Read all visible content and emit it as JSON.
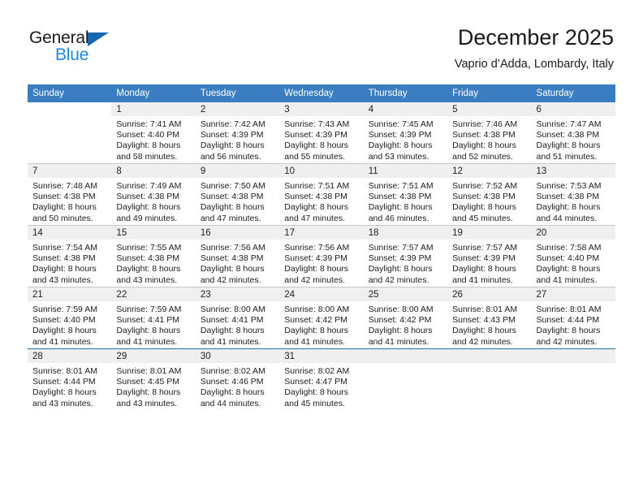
{
  "brand": {
    "name_top": "General",
    "name_bottom": "Blue",
    "accent_color": "#1e87df",
    "triangle_color": "#1567b2"
  },
  "header": {
    "title": "December 2025",
    "subtitle": "Vaprio d’Adda, Lombardy, Italy"
  },
  "calendar": {
    "header_bg": "#3a7dc0",
    "daynum_band_bg": "#efefef",
    "weekday_headers": [
      "Sunday",
      "Monday",
      "Tuesday",
      "Wednesday",
      "Thursday",
      "Friday",
      "Saturday"
    ],
    "weeks": [
      [
        {
          "day": "",
          "sunrise": "",
          "sunset": "",
          "daylight_line1": "",
          "daylight_line2": ""
        },
        {
          "day": "1",
          "sunrise": "Sunrise: 7:41 AM",
          "sunset": "Sunset: 4:40 PM",
          "daylight_line1": "Daylight: 8 hours",
          "daylight_line2": "and 58 minutes."
        },
        {
          "day": "2",
          "sunrise": "Sunrise: 7:42 AM",
          "sunset": "Sunset: 4:39 PM",
          "daylight_line1": "Daylight: 8 hours",
          "daylight_line2": "and 56 minutes."
        },
        {
          "day": "3",
          "sunrise": "Sunrise: 7:43 AM",
          "sunset": "Sunset: 4:39 PM",
          "daylight_line1": "Daylight: 8 hours",
          "daylight_line2": "and 55 minutes."
        },
        {
          "day": "4",
          "sunrise": "Sunrise: 7:45 AM",
          "sunset": "Sunset: 4:39 PM",
          "daylight_line1": "Daylight: 8 hours",
          "daylight_line2": "and 53 minutes."
        },
        {
          "day": "5",
          "sunrise": "Sunrise: 7:46 AM",
          "sunset": "Sunset: 4:38 PM",
          "daylight_line1": "Daylight: 8 hours",
          "daylight_line2": "and 52 minutes."
        },
        {
          "day": "6",
          "sunrise": "Sunrise: 7:47 AM",
          "sunset": "Sunset: 4:38 PM",
          "daylight_line1": "Daylight: 8 hours",
          "daylight_line2": "and 51 minutes."
        }
      ],
      [
        {
          "day": "7",
          "sunrise": "Sunrise: 7:48 AM",
          "sunset": "Sunset: 4:38 PM",
          "daylight_line1": "Daylight: 8 hours",
          "daylight_line2": "and 50 minutes."
        },
        {
          "day": "8",
          "sunrise": "Sunrise: 7:49 AM",
          "sunset": "Sunset: 4:38 PM",
          "daylight_line1": "Daylight: 8 hours",
          "daylight_line2": "and 49 minutes."
        },
        {
          "day": "9",
          "sunrise": "Sunrise: 7:50 AM",
          "sunset": "Sunset: 4:38 PM",
          "daylight_line1": "Daylight: 8 hours",
          "daylight_line2": "and 47 minutes."
        },
        {
          "day": "10",
          "sunrise": "Sunrise: 7:51 AM",
          "sunset": "Sunset: 4:38 PM",
          "daylight_line1": "Daylight: 8 hours",
          "daylight_line2": "and 47 minutes."
        },
        {
          "day": "11",
          "sunrise": "Sunrise: 7:51 AM",
          "sunset": "Sunset: 4:38 PM",
          "daylight_line1": "Daylight: 8 hours",
          "daylight_line2": "and 46 minutes."
        },
        {
          "day": "12",
          "sunrise": "Sunrise: 7:52 AM",
          "sunset": "Sunset: 4:38 PM",
          "daylight_line1": "Daylight: 8 hours",
          "daylight_line2": "and 45 minutes."
        },
        {
          "day": "13",
          "sunrise": "Sunrise: 7:53 AM",
          "sunset": "Sunset: 4:38 PM",
          "daylight_line1": "Daylight: 8 hours",
          "daylight_line2": "and 44 minutes."
        }
      ],
      [
        {
          "day": "14",
          "sunrise": "Sunrise: 7:54 AM",
          "sunset": "Sunset: 4:38 PM",
          "daylight_line1": "Daylight: 8 hours",
          "daylight_line2": "and 43 minutes."
        },
        {
          "day": "15",
          "sunrise": "Sunrise: 7:55 AM",
          "sunset": "Sunset: 4:38 PM",
          "daylight_line1": "Daylight: 8 hours",
          "daylight_line2": "and 43 minutes."
        },
        {
          "day": "16",
          "sunrise": "Sunrise: 7:56 AM",
          "sunset": "Sunset: 4:38 PM",
          "daylight_line1": "Daylight: 8 hours",
          "daylight_line2": "and 42 minutes."
        },
        {
          "day": "17",
          "sunrise": "Sunrise: 7:56 AM",
          "sunset": "Sunset: 4:39 PM",
          "daylight_line1": "Daylight: 8 hours",
          "daylight_line2": "and 42 minutes."
        },
        {
          "day": "18",
          "sunrise": "Sunrise: 7:57 AM",
          "sunset": "Sunset: 4:39 PM",
          "daylight_line1": "Daylight: 8 hours",
          "daylight_line2": "and 42 minutes."
        },
        {
          "day": "19",
          "sunrise": "Sunrise: 7:57 AM",
          "sunset": "Sunset: 4:39 PM",
          "daylight_line1": "Daylight: 8 hours",
          "daylight_line2": "and 41 minutes."
        },
        {
          "day": "20",
          "sunrise": "Sunrise: 7:58 AM",
          "sunset": "Sunset: 4:40 PM",
          "daylight_line1": "Daylight: 8 hours",
          "daylight_line2": "and 41 minutes."
        }
      ],
      [
        {
          "day": "21",
          "sunrise": "Sunrise: 7:59 AM",
          "sunset": "Sunset: 4:40 PM",
          "daylight_line1": "Daylight: 8 hours",
          "daylight_line2": "and 41 minutes."
        },
        {
          "day": "22",
          "sunrise": "Sunrise: 7:59 AM",
          "sunset": "Sunset: 4:41 PM",
          "daylight_line1": "Daylight: 8 hours",
          "daylight_line2": "and 41 minutes."
        },
        {
          "day": "23",
          "sunrise": "Sunrise: 8:00 AM",
          "sunset": "Sunset: 4:41 PM",
          "daylight_line1": "Daylight: 8 hours",
          "daylight_line2": "and 41 minutes."
        },
        {
          "day": "24",
          "sunrise": "Sunrise: 8:00 AM",
          "sunset": "Sunset: 4:42 PM",
          "daylight_line1": "Daylight: 8 hours",
          "daylight_line2": "and 41 minutes."
        },
        {
          "day": "25",
          "sunrise": "Sunrise: 8:00 AM",
          "sunset": "Sunset: 4:42 PM",
          "daylight_line1": "Daylight: 8 hours",
          "daylight_line2": "and 41 minutes."
        },
        {
          "day": "26",
          "sunrise": "Sunrise: 8:01 AM",
          "sunset": "Sunset: 4:43 PM",
          "daylight_line1": "Daylight: 8 hours",
          "daylight_line2": "and 42 minutes."
        },
        {
          "day": "27",
          "sunrise": "Sunrise: 8:01 AM",
          "sunset": "Sunset: 4:44 PM",
          "daylight_line1": "Daylight: 8 hours",
          "daylight_line2": "and 42 minutes."
        }
      ],
      [
        {
          "day": "28",
          "sunrise": "Sunrise: 8:01 AM",
          "sunset": "Sunset: 4:44 PM",
          "daylight_line1": "Daylight: 8 hours",
          "daylight_line2": "and 43 minutes."
        },
        {
          "day": "29",
          "sunrise": "Sunrise: 8:01 AM",
          "sunset": "Sunset: 4:45 PM",
          "daylight_line1": "Daylight: 8 hours",
          "daylight_line2": "and 43 minutes."
        },
        {
          "day": "30",
          "sunrise": "Sunrise: 8:02 AM",
          "sunset": "Sunset: 4:46 PM",
          "daylight_line1": "Daylight: 8 hours",
          "daylight_line2": "and 44 minutes."
        },
        {
          "day": "31",
          "sunrise": "Sunrise: 8:02 AM",
          "sunset": "Sunset: 4:47 PM",
          "daylight_line1": "Daylight: 8 hours",
          "daylight_line2": "and 45 minutes."
        },
        {
          "day": "",
          "sunrise": "",
          "sunset": "",
          "daylight_line1": "",
          "daylight_line2": ""
        },
        {
          "day": "",
          "sunrise": "",
          "sunset": "",
          "daylight_line1": "",
          "daylight_line2": ""
        },
        {
          "day": "",
          "sunrise": "",
          "sunset": "",
          "daylight_line1": "",
          "daylight_line2": ""
        }
      ]
    ]
  }
}
